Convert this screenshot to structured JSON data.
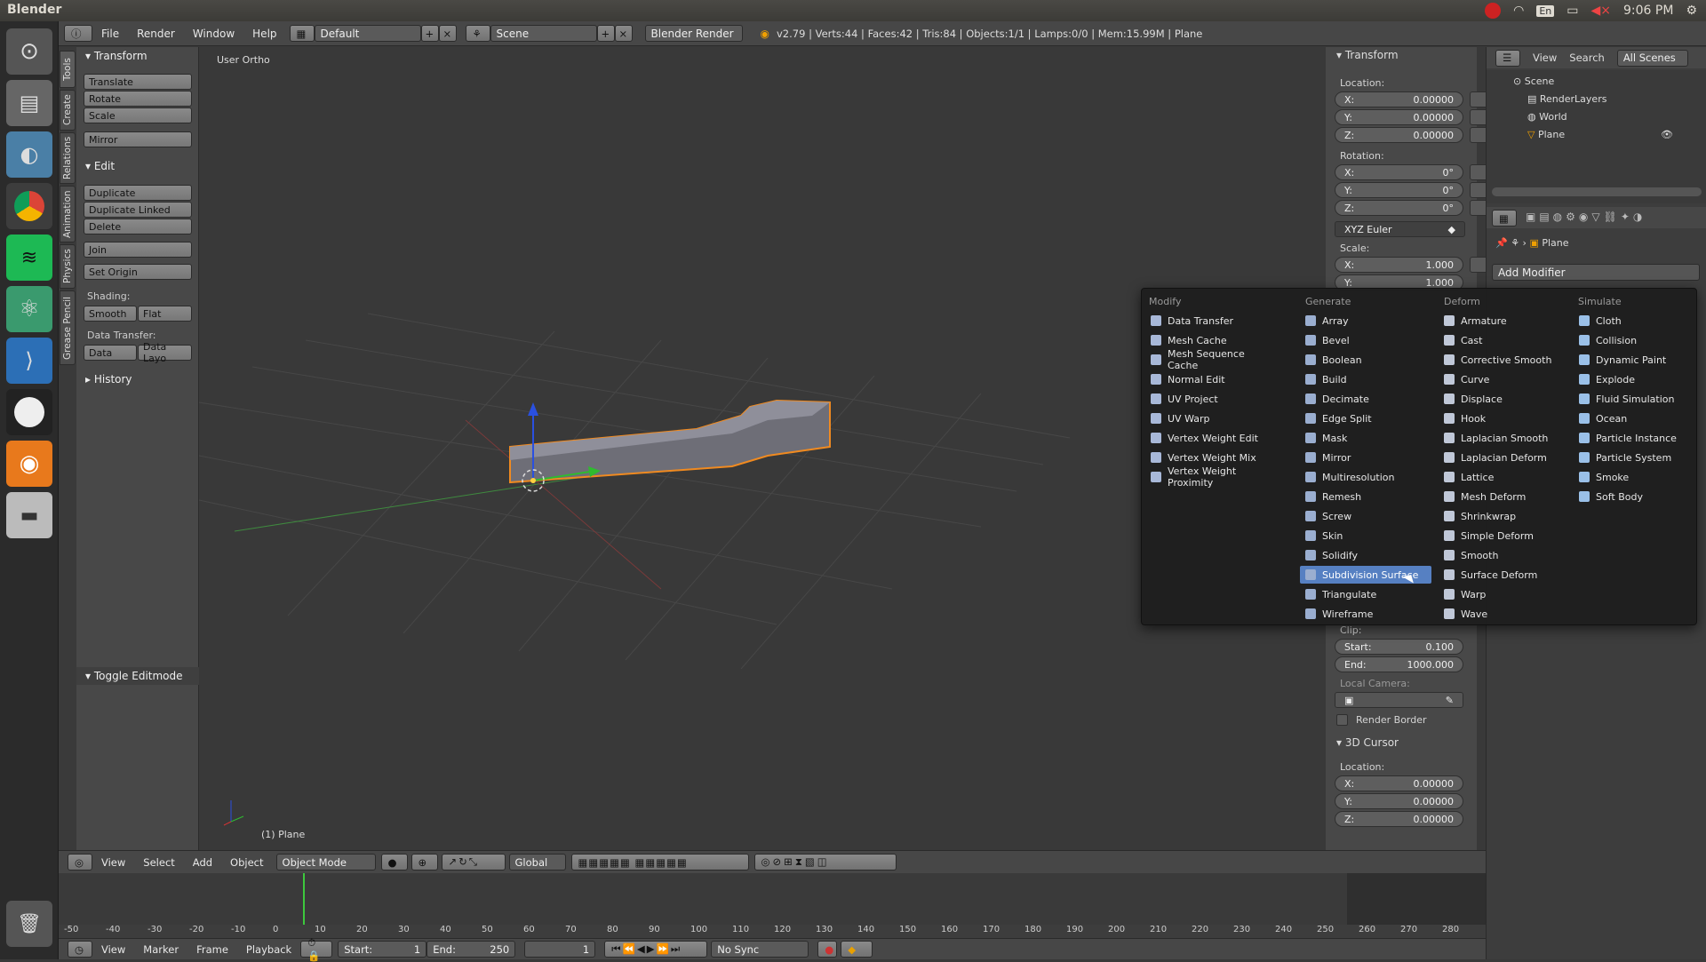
{
  "app": {
    "name": "Blender",
    "time": "9:06 PM",
    "lang": "En"
  },
  "header": {
    "menus": [
      "File",
      "Render",
      "Window",
      "Help"
    ],
    "screen": "Default",
    "scene": "Scene",
    "engine": "Blender Render",
    "stats": "v2.79 | Verts:44 | Faces:42 | Tris:84 | Objects:1/1 | Lamps:0/0 | Mem:15.99M | Plane"
  },
  "left_tabs": [
    "Tools",
    "Create",
    "Relations",
    "Animation",
    "Physics",
    "Grease Pencil"
  ],
  "tools": {
    "transform": "Transform",
    "translate": "Translate",
    "rotate": "Rotate",
    "scale": "Scale",
    "mirror": "Mirror",
    "edit": "Edit",
    "duplicate": "Duplicate",
    "duplicate_linked": "Duplicate Linked",
    "delete": "Delete",
    "join": "Join",
    "set_origin": "Set Origin",
    "shading": "Shading:",
    "smooth": "Smooth",
    "flat": "Flat",
    "data_transfer": "Data Transfer:",
    "data": "Data",
    "data_layo": "Data Layo",
    "history": "History",
    "toggle_editmode": "Toggle Editmode"
  },
  "viewport": {
    "view_label": "User Ortho",
    "object_label": "(1) Plane"
  },
  "npanel": {
    "transform": "Transform",
    "location": "Location:",
    "loc": [
      "0.00000",
      "0.00000",
      "0.00000"
    ],
    "rotation": "Rotation:",
    "rot": [
      "0°",
      "0°",
      "0°"
    ],
    "euler": "XYZ Euler",
    "scale": "Scale:",
    "scl": [
      "1.000",
      "1.000"
    ],
    "clip": "Clip:",
    "clip_start": "0.100",
    "clip_end": "1000.000",
    "start": "Start:",
    "end": "End:",
    "local_camera": "Local Camera:",
    "render_border": "Render Border",
    "cursor": "3D Cursor",
    "cursor_location": "Location:",
    "cur": [
      "0.00000",
      "0.00000",
      "0.00000"
    ]
  },
  "outliner": {
    "view": "View",
    "search": "Search",
    "all_scenes": "All Scenes",
    "items": [
      "Scene",
      "RenderLayers",
      "World",
      "Plane"
    ]
  },
  "properties": {
    "object": "Plane",
    "add_modifier": "Add Modifier"
  },
  "modifier_menu": {
    "columns": [
      {
        "title": "Modify",
        "items": [
          "Data Transfer",
          "Mesh Cache",
          "Mesh Sequence Cache",
          "Normal Edit",
          "UV Project",
          "UV Warp",
          "Vertex Weight Edit",
          "Vertex Weight Mix",
          "Vertex Weight Proximity"
        ]
      },
      {
        "title": "Generate",
        "items": [
          "Array",
          "Bevel",
          "Boolean",
          "Build",
          "Decimate",
          "Edge Split",
          "Mask",
          "Mirror",
          "Multiresolution",
          "Remesh",
          "Screw",
          "Skin",
          "Solidify",
          "Subdivision Surface",
          "Triangulate",
          "Wireframe"
        ]
      },
      {
        "title": "Deform",
        "items": [
          "Armature",
          "Cast",
          "Corrective Smooth",
          "Curve",
          "Displace",
          "Hook",
          "Laplacian Smooth",
          "Laplacian Deform",
          "Lattice",
          "Mesh Deform",
          "Shrinkwrap",
          "Simple Deform",
          "Smooth",
          "Surface Deform",
          "Warp",
          "Wave"
        ]
      },
      {
        "title": "Simulate",
        "items": [
          "Cloth",
          "Collision",
          "Dynamic Paint",
          "Explode",
          "Fluid Simulation",
          "Ocean",
          "Particle Instance",
          "Particle System",
          "Smoke",
          "Soft Body"
        ]
      }
    ],
    "selected": "Subdivision Surface"
  },
  "view3d_header": {
    "menus": [
      "View",
      "Select",
      "Add",
      "Object"
    ],
    "mode": "Object Mode",
    "orientation": "Global"
  },
  "timeline": {
    "ticks": [
      "-50",
      "-40",
      "-30",
      "-20",
      "-10",
      "0",
      "10",
      "20",
      "30",
      "40",
      "50",
      "60",
      "70",
      "80",
      "90",
      "100",
      "110",
      "120",
      "130",
      "140",
      "150",
      "160",
      "170",
      "180",
      "190",
      "200",
      "210",
      "220",
      "230",
      "240",
      "250",
      "260",
      "270",
      "280"
    ],
    "menus": [
      "View",
      "Marker",
      "Frame",
      "Playback"
    ],
    "start_label": "Start:",
    "start": "1",
    "end_label": "End:",
    "end": "250",
    "current": "1",
    "sync": "No Sync"
  }
}
